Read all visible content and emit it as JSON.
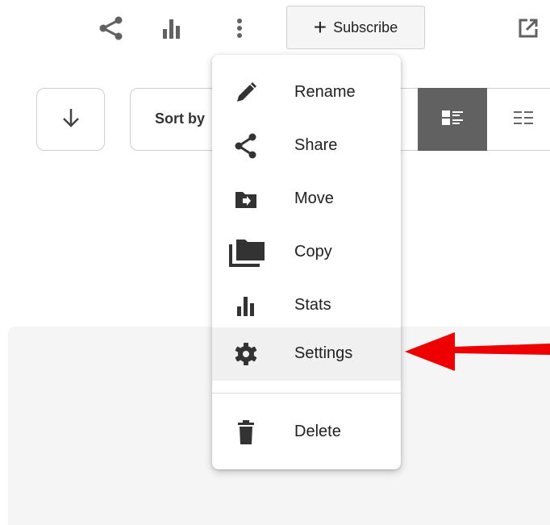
{
  "toolbar": {
    "icons": [
      "share-icon",
      "stats-icon",
      "more-vert-icon",
      "open-in-new-icon"
    ],
    "subscribe_label": "Subscribe",
    "subscribe_plus": "+"
  },
  "controls": {
    "sort_label": "Sort by",
    "view_modes": [
      "list-view-icon",
      "grid-view-icon"
    ]
  },
  "menu": {
    "items": [
      {
        "label": "Rename",
        "icon": "pencil-icon"
      },
      {
        "label": "Share",
        "icon": "share-icon"
      },
      {
        "label": "Move",
        "icon": "folder-move-icon"
      },
      {
        "label": "Copy",
        "icon": "folders-copy-icon"
      },
      {
        "label": "Stats",
        "icon": "stats-icon"
      },
      {
        "label": "Settings",
        "icon": "gear-icon"
      },
      {
        "label": "Delete",
        "icon": "trash-icon"
      }
    ],
    "highlighted": "Settings"
  },
  "colors": {
    "icon": "#616161",
    "menu_icon": "#333333",
    "active_view_bg": "#616161",
    "arrow": "#ee0000",
    "panel_bg": "#f5f5f5"
  }
}
